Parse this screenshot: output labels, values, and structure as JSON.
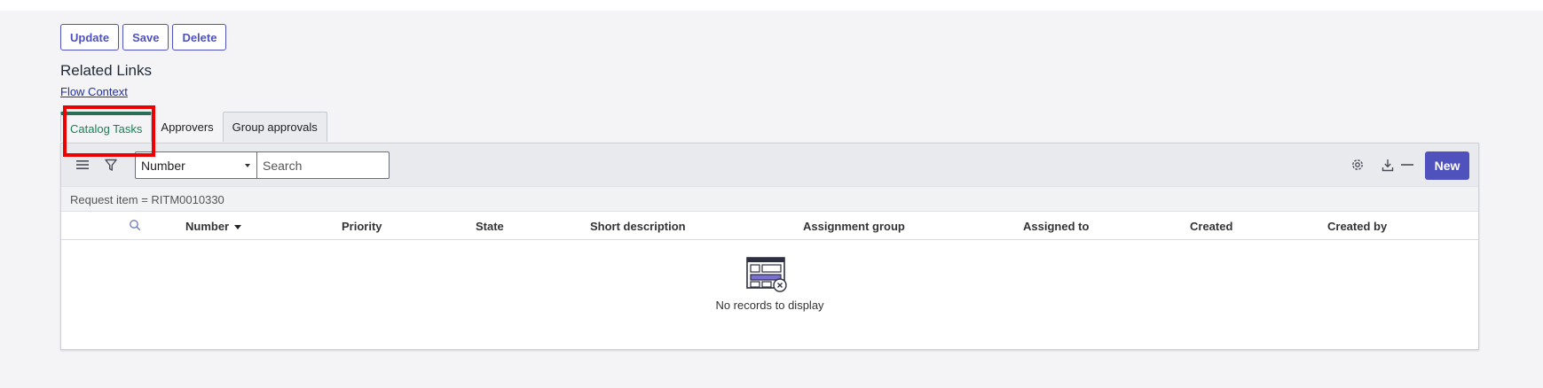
{
  "actions": {
    "update": "Update",
    "save": "Save",
    "delete": "Delete"
  },
  "related": {
    "title": "Related Links",
    "flow_link": "Flow Context"
  },
  "tabs": [
    {
      "label": "Catalog Tasks",
      "active": true
    },
    {
      "label": "Approvers",
      "active": false
    },
    {
      "label": "Group approvals",
      "active": false
    }
  ],
  "list": {
    "field_select": "Number",
    "search_placeholder": "Search",
    "new_label": "New",
    "filter_text": "Request item = RITM0010330",
    "columns": [
      "Number",
      "Priority",
      "State",
      "Short description",
      "Assignment group",
      "Assigned to",
      "Created",
      "Created by"
    ],
    "sorted_column": "Number",
    "sort_direction": "descending",
    "empty_message": "No records to display"
  },
  "colors": {
    "accent": "#4f52bd",
    "active_tab": "#1a7f53",
    "highlight": "#ee0000"
  },
  "icons": [
    "hamburger-icon",
    "filter-icon",
    "search-icon",
    "gear-icon",
    "download-icon",
    "minimize-icon",
    "empty-list-icon"
  ]
}
